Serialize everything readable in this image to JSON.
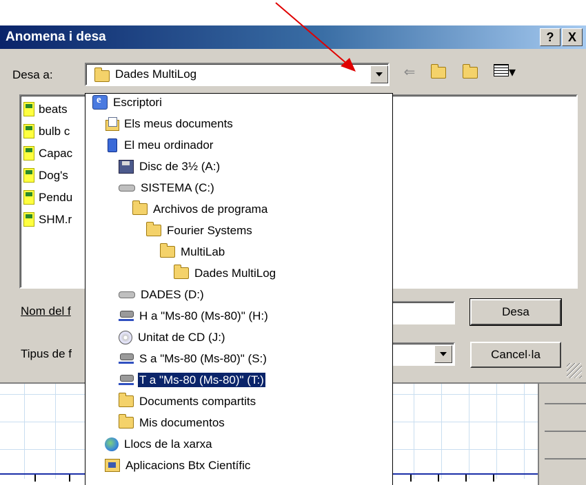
{
  "dialog": {
    "title": "Anomena i desa",
    "help_label": "?",
    "close_label": "X"
  },
  "save_in": {
    "label": "Desa a:",
    "current": "Dades MultiLog"
  },
  "file_list": [
    {
      "name": "beats",
      "icon": "file-icon"
    },
    {
      "name": "bulb c",
      "icon": "file-icon"
    },
    {
      "name": "Capac",
      "icon": "file-icon"
    },
    {
      "name": "Dog's",
      "icon": "file-icon"
    },
    {
      "name": "Pendu",
      "icon": "file-icon"
    },
    {
      "name": "SHM.r",
      "icon": "file-icon"
    }
  ],
  "dropdown_items": [
    {
      "label": "Escriptori",
      "icon": "desktop-icon"
    },
    {
      "label": "Els meus documents",
      "icon": "docs-icon"
    },
    {
      "label": "El meu ordinador",
      "icon": "computer-icon"
    },
    {
      "label": "Disc de 3½ (A:)",
      "icon": "floppy-icon"
    },
    {
      "label": "SISTEMA (C:)",
      "icon": "drive-icon"
    },
    {
      "label": "Archivos de programa",
      "icon": "folder-icon"
    },
    {
      "label": "Fourier Systems",
      "icon": "folder-icon"
    },
    {
      "label": "MultiLab",
      "icon": "folder-icon"
    },
    {
      "label": "Dades MultiLog",
      "icon": "folder-icon"
    },
    {
      "label": "DADES (D:)",
      "icon": "drive-icon"
    },
    {
      "label": "H a \"Ms-80 (Ms-80)\" (H:)",
      "icon": "net-icon"
    },
    {
      "label": "Unitat de CD (J:)",
      "icon": "cd-icon"
    },
    {
      "label": "S a \"Ms-80 (Ms-80)\" (S:)",
      "icon": "net-icon"
    },
    {
      "label": "T a \"Ms-80 (Ms-80)\" (T:)",
      "icon": "net-icon",
      "selected": true
    },
    {
      "label": "Documents compartits",
      "icon": "folder-icon"
    },
    {
      "label": "Mis documentos",
      "icon": "folder-icon"
    },
    {
      "label": "Llocs de la xarxa",
      "icon": "globe-icon"
    },
    {
      "label": "Aplicacions Btx Científic",
      "icon": "apps-icon"
    }
  ],
  "filename": {
    "label": "Nom del f",
    "value": ""
  },
  "filetype": {
    "label": "Tipus de f",
    "value": ""
  },
  "buttons": {
    "save": "Desa",
    "cancel": "Cancel·la"
  },
  "colors": {
    "title_start": "#0a246a",
    "title_end": "#a6caf0",
    "dialog_bg": "#d4d0c8",
    "selection": "#0a246a",
    "annotation_arrow": "#e00000"
  }
}
